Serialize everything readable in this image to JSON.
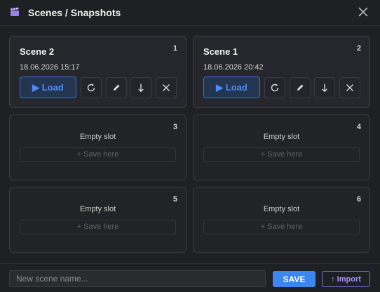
{
  "header": {
    "icon": "clapperboard-icon",
    "title": "Scenes / Snapshots",
    "close_icon": "close-icon"
  },
  "slots": [
    {
      "number": "1",
      "state": "filled",
      "name": "Scene 2",
      "date": "18.06.2026 15:17",
      "load_label": "Load"
    },
    {
      "number": "2",
      "state": "filled",
      "name": "Scene 1",
      "date": "18.06.2026 20:42",
      "load_label": "Load"
    },
    {
      "number": "3",
      "state": "empty",
      "empty_label": "Empty slot",
      "save_label": "+ Save here"
    },
    {
      "number": "4",
      "state": "empty",
      "empty_label": "Empty slot",
      "save_label": "+ Save here"
    },
    {
      "number": "5",
      "state": "empty",
      "empty_label": "Empty slot",
      "save_label": "+ Save here"
    },
    {
      "number": "6",
      "state": "empty",
      "empty_label": "Empty slot",
      "save_label": "+ Save here"
    }
  ],
  "slot_actions": [
    "reload-icon",
    "pencil-icon",
    "arrow-down-icon",
    "close-icon"
  ],
  "footer": {
    "name_placeholder": "New scene name...",
    "name_value": "",
    "save_label": "SAVE",
    "import_label": "↑ Import"
  },
  "colors": {
    "accent": "#3b86f0",
    "load_text": "#4d8cf5",
    "import_accent": "#a892f5",
    "background": "#1f2023"
  }
}
